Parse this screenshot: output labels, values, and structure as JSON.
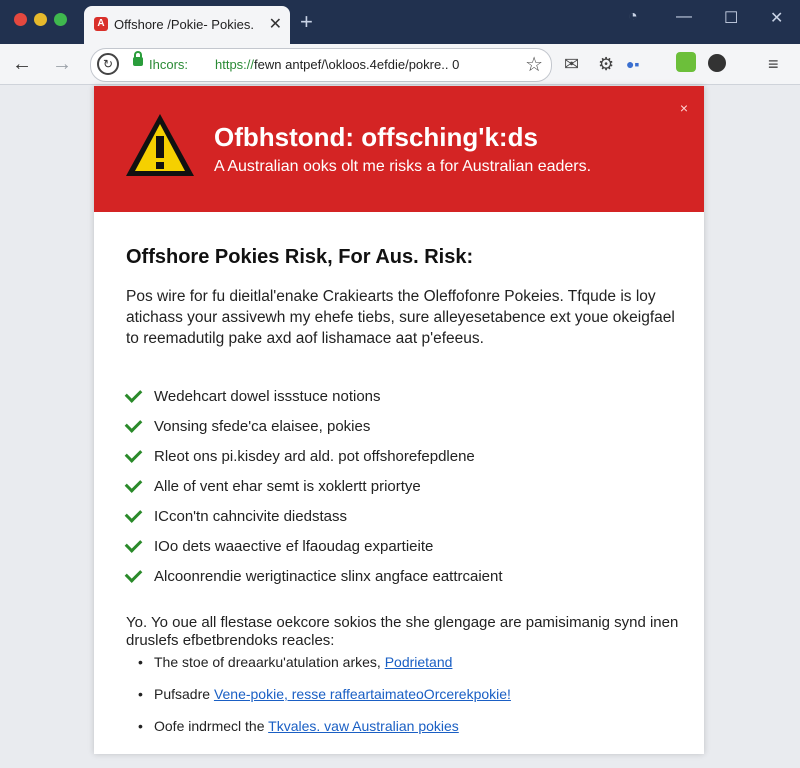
{
  "browser": {
    "tab_title": "Offshore /Pokie- Pokies.",
    "tab_favicon": "A",
    "secure_label": "Ihcors:",
    "url_scheme": "https://",
    "url_rest": "fewn antpef/\\okloos.4efdie/pokre..",
    "url_suffix": "0",
    "icons": [
      "back-icon",
      "forward-icon",
      "reload-icon",
      "lock-icon",
      "star-icon",
      "mail-icon",
      "gear-icon",
      "extension-icon",
      "profile-icon",
      "menu-icon"
    ]
  },
  "banner": {
    "title": "Ofbhstond: offsching'k:ds",
    "subtitle": "A Australian ooks olt me risks a for Australian eaders.",
    "close": "×",
    "color": "#d42424"
  },
  "content": {
    "heading": "Offshore Pokies Risk, For Aus. Risk:",
    "intro": "Pos wire for fu dieitlal'enake Crakiearts the Oleffofonre Pokeies. Tfqude is loy atichass your assivewh my ehefe tiebs, sure alleyesetabence ext youe okeigfael to reemadutilg pake axd aof lishamace aat p'efeeus.",
    "checklist": [
      "Wedehcart dowel issstuce notions",
      "Vonsing sfede'ca elaisee, pokies",
      "Rleot ons pi.kisdey ard ald. pot offshorefepdlene",
      "Alle of vent ehar semt is xoklertt priortye",
      "ICcon'tn cahncivite diedstass",
      "IOo dets waaective ef lfaoudag expartieite",
      "Alcoonrendie werigtinactice slinx angface eattrcaient"
    ],
    "note": "Yo. Yo oue all flestase oekcore sokios the she glengage are pamisimanig synd inen druslefs efbetbrendoks reacles:",
    "bullets": [
      {
        "text": "The stoe of dreaarku'atulation arkes,",
        "link": "Podrietand"
      },
      {
        "text": "Pufsadre",
        "link": "Vene-pokie, resse raffeartaimateoOrcerekpokie!"
      },
      {
        "text": "Oofe indrmecl the",
        "link": "Tkvales. vaw Australian pokies"
      }
    ]
  },
  "colors": {
    "titlebar": "#21314f",
    "accent_green": "#2a8a2a",
    "link": "#1a5fc4"
  }
}
